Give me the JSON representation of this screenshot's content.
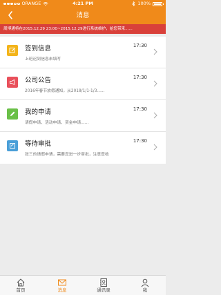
{
  "status": {
    "carrier": "ORANGE",
    "time": "4:21 PM",
    "battery": "100%"
  },
  "header": {
    "title": "消息",
    "back_icon": "chevron-left-icon"
  },
  "notice": {
    "text": "周博通将在2015.12.29 23:00~2015.12.29进行系统维护，给您带来......"
  },
  "messages": [
    {
      "title": "签到信息",
      "subtitle": "上班迟到信息未填写",
      "time": "17:30",
      "icon": "edit-icon",
      "color": "#f3b41a"
    },
    {
      "title": "公司公告",
      "subtitle": "2016年春节放假通知，从2018/1/1-1/3......",
      "time": "17:30",
      "icon": "megaphone-icon",
      "color": "#e9505b"
    },
    {
      "title": "我的申请",
      "subtitle": "请假申请、活动申请、资金申请......",
      "time": "17:30",
      "icon": "pencil-icon",
      "color": "#6ac048"
    },
    {
      "title": "等待审批",
      "subtitle": "张三的请假申请，需要您进一步审批，注意查收",
      "time": "17:30",
      "icon": "approval-icon",
      "color": "#4a9fd8"
    }
  ],
  "tabs": [
    {
      "label": "首页",
      "icon": "home-icon",
      "active": false
    },
    {
      "label": "消息",
      "icon": "mail-icon",
      "active": true
    },
    {
      "label": "通讯录",
      "icon": "contacts-icon",
      "active": false
    },
    {
      "label": "我",
      "icon": "user-icon",
      "active": false
    }
  ],
  "colors": {
    "brand": "#f08a1a",
    "notice_bg": "#d9403a"
  }
}
